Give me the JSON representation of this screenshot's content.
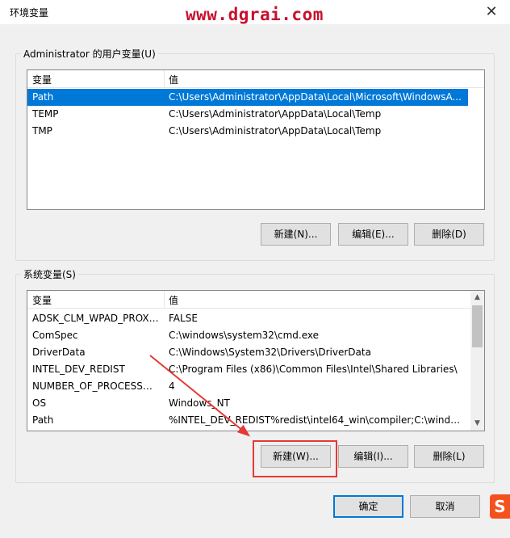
{
  "window": {
    "title": "环境变量",
    "watermark": "www.dgrai.com"
  },
  "user_vars": {
    "group_label": "Administrator 的用户变量(U)",
    "col_var": "变量",
    "col_val": "值",
    "rows": [
      {
        "name": "Path",
        "value": "C:\\Users\\Administrator\\AppData\\Local\\Microsoft\\WindowsA...",
        "selected": true
      },
      {
        "name": "TEMP",
        "value": "C:\\Users\\Administrator\\AppData\\Local\\Temp"
      },
      {
        "name": "TMP",
        "value": "C:\\Users\\Administrator\\AppData\\Local\\Temp"
      }
    ],
    "btn_new": "新建(N)...",
    "btn_edit": "编辑(E)...",
    "btn_delete": "删除(D)"
  },
  "sys_vars": {
    "group_label": "系统变量(S)",
    "col_var": "变量",
    "col_val": "值",
    "rows": [
      {
        "name": "ADSK_CLM_WPAD_PROXY...",
        "value": "FALSE"
      },
      {
        "name": "ComSpec",
        "value": "C:\\windows\\system32\\cmd.exe"
      },
      {
        "name": "DriverData",
        "value": "C:\\Windows\\System32\\Drivers\\DriverData"
      },
      {
        "name": "INTEL_DEV_REDIST",
        "value": "C:\\Program Files (x86)\\Common Files\\Intel\\Shared Libraries\\"
      },
      {
        "name": "NUMBER_OF_PROCESSORS",
        "value": "4"
      },
      {
        "name": "OS",
        "value": "Windows_NT"
      },
      {
        "name": "Path",
        "value": "%INTEL_DEV_REDIST%redist\\intel64_win\\compiler;C:\\windows..."
      }
    ],
    "btn_new": "新建(W)...",
    "btn_edit": "编辑(I)...",
    "btn_delete": "删除(L)"
  },
  "footer": {
    "ok": "确定",
    "cancel": "取消"
  },
  "icons": {
    "close": "close-icon",
    "scroll_up": "chevron-up-icon",
    "scroll_down": "chevron-down-icon"
  },
  "colors": {
    "selection": "#0078d7",
    "annotation": "#e53935",
    "watermark": "#c8102e"
  }
}
